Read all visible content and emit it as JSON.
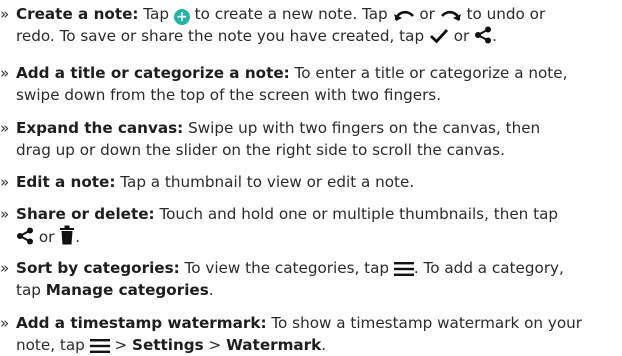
{
  "bullet": "»",
  "items": [
    {
      "title": "Create a note:",
      "t1": "Tap",
      "t2": "to create a new note. Tap",
      "t3": "or",
      "t4": "to undo or",
      "t5": "redo. To save or share the note you have created, tap",
      "t6": "or",
      "t7": "."
    },
    {
      "title": "Add a title or categorize a note:",
      "t1": "To enter a title or categorize a note,",
      "t2": "swipe down from the top of the screen with two fingers."
    },
    {
      "title": "Expand the canvas:",
      "t1": "Swipe up with two fingers on the canvas, then",
      "t2": "drag up or down the slider on the right side to scroll the canvas."
    },
    {
      "title": "Edit a note:",
      "t1": "Tap a thumbnail to view or edit a note."
    },
    {
      "title": "Share or delete:",
      "t1": "Touch and hold one or multiple thumbnails, then tap",
      "t2": "or",
      "t3": "."
    },
    {
      "title": "Sort by categories:",
      "t1": "To view the categories, tap",
      "t2": ". To add a category,",
      "t3": "tap",
      "t4": "Manage categories",
      "t5": "."
    },
    {
      "title": "Add a timestamp watermark:",
      "t1": "To show a timestamp watermark on your",
      "t2": "note, tap",
      "t3": ">",
      "t4": "Settings",
      "t5": ">",
      "t6": "Watermark",
      "t7": "."
    }
  ],
  "icons": {
    "add": "plus-circle-icon",
    "undo": "undo-arrow-icon",
    "redo": "redo-arrow-icon",
    "save": "checkmark-icon",
    "share": "share-icon",
    "delete": "trash-icon",
    "menu": "menu-icon",
    "accent_color": "#24b5a2"
  }
}
